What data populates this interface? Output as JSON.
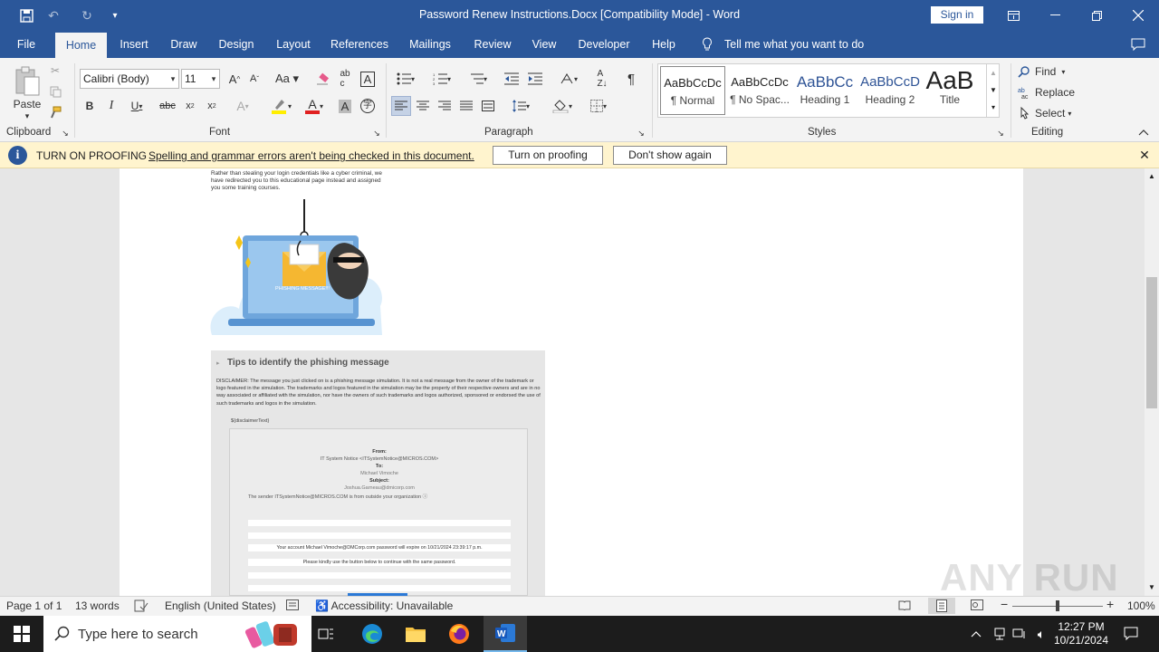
{
  "titlebar": {
    "title": "Password Renew Instructions.Docx [Compatibility Mode]  -  Word",
    "signin": "Sign in"
  },
  "tabs": [
    "File",
    "Home",
    "Insert",
    "Draw",
    "Design",
    "Layout",
    "References",
    "Mailings",
    "Review",
    "View",
    "Developer",
    "Help"
  ],
  "tellme": "Tell me what you want to do",
  "ribbon": {
    "paste": "Paste",
    "font_name": "Calibri (Body)",
    "font_size": "11",
    "groups": {
      "clipboard": "Clipboard",
      "font": "Font",
      "paragraph": "Paragraph",
      "styles": "Styles",
      "editing": "Editing"
    },
    "styles": [
      {
        "preview": "AaBbCcDc",
        "name": "¶ Normal"
      },
      {
        "preview": "AaBbCcDc",
        "name": "¶ No Spac..."
      },
      {
        "preview": "AaBbCc",
        "name": "Heading 1"
      },
      {
        "preview": "AaBbCcD",
        "name": "Heading 2"
      },
      {
        "preview": "AaB",
        "name": "Title"
      }
    ],
    "find": "Find",
    "replace": "Replace",
    "select": "Select"
  },
  "infobar": {
    "title": "TURN ON PROOFING",
    "message": "Spelling and grammar errors aren't being checked in this document.",
    "btn_on": "Turn on proofing",
    "btn_dismiss": "Don't show again"
  },
  "doc": {
    "intro": "Rather than stealing your login credentials like a cyber criminal, we have redirected you to this educational page instead and assigned you some training courses.",
    "laptop_label": "PHISHING MESSAGE!!!",
    "tips_title": "Tips to identify the phishing message",
    "disclaimer": "DISCLAIMER: The message you just clicked on is a phishing message simulation. It is not a real message from the owner of the trademark or logo featured in the simulation. The trademarks and logos featured in the simulation may be the property of their respective owners and are in no way associated or affiliated with the simulation, nor have the owners of such trademarks and logos authorized, sponsored or endorsed the use of such trademarks and logos in the simulation.",
    "placeholder": "${disclaimerText}",
    "from_label": "From:",
    "from_value": "IT System Notice <ITSystemNotice@MICROS.COM>",
    "to_label": "To:",
    "to_value": "Michael Vimoche",
    "subject_label": "Subject:",
    "subject_value": "Joshua.Garneau@dmicorp.com",
    "outside_note": "The sender ITSystemNotice@MICROS.COM is from outside your organization",
    "expire_line": "Your account Michael Vimoche@DMCorp.com password will expire on 10/21/2024 23:39:17 p.m.",
    "continue_line": "Please kindly use the button below to continue with the same password."
  },
  "statusbar": {
    "page": "Page 1 of 1",
    "words": "13 words",
    "language": "English (United States)",
    "accessibility": "Accessibility: Unavailable",
    "zoom": "100%"
  },
  "taskbar": {
    "search": "Type here to search",
    "time": "12:27 PM",
    "date": "10/21/2024"
  },
  "watermark": "ANY RUN",
  "colors": {
    "word_blue": "#2b579a",
    "info_bar": "#fff4ce",
    "font_red": "#e02020",
    "highlight_yellow": "#ffee00"
  }
}
